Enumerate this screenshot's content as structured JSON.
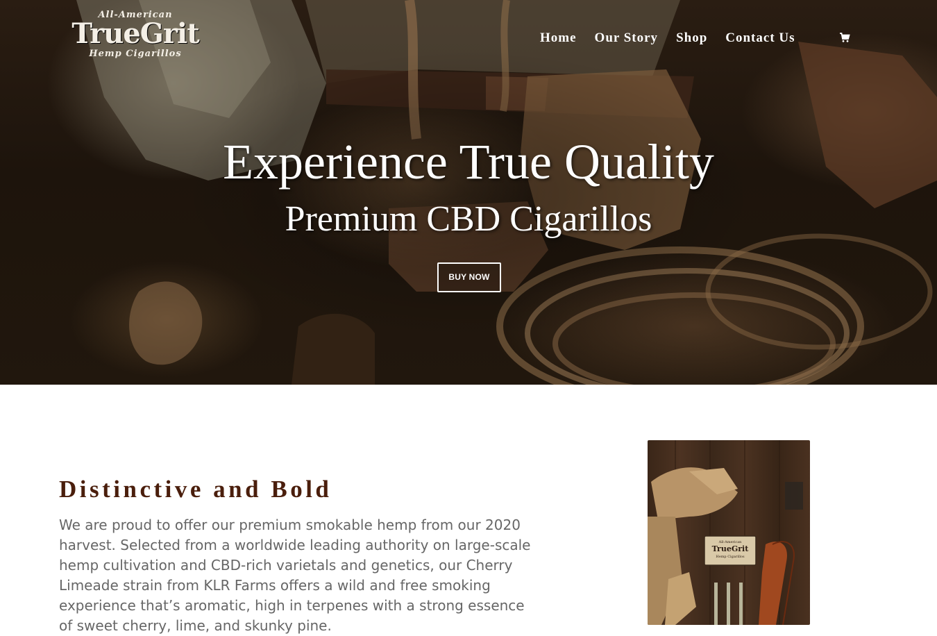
{
  "brand": {
    "tagline_top": "All-American",
    "name": "TrueGrit",
    "tagline_bottom": "Hemp Cigarillos"
  },
  "nav": {
    "items": [
      {
        "label": "Home"
      },
      {
        "label": "Our Story"
      },
      {
        "label": "Shop"
      },
      {
        "label": "Contact Us"
      }
    ],
    "cart_icon": "shopping-cart-icon"
  },
  "hero": {
    "headline": "Experience True Quality",
    "subheadline": "Premium CBD Cigarillos",
    "cta_label": "BUY NOW"
  },
  "intro": {
    "title": "Distinctive and Bold",
    "body": "We are proud to offer our premium smokable hemp from our 2020 harvest. Selected from a worldwide leading authority on large-scale hemp cultivation and CBD-rich varietals and genetics, our Cherry Limeade strain from KLR Farms offers a wild and free smoking experience that’s aromatic, high in terpenes with a strong essence of sweet cherry, lime, and skunky pine."
  },
  "product_card": {
    "tin_brand_top": "All-American",
    "tin_brand": "TrueGrit",
    "tin_brand_bottom": "Hemp Cigarillos"
  },
  "colors": {
    "title": "#4a1e0c",
    "body_text": "#666666",
    "hero_text": "#ffffff"
  }
}
